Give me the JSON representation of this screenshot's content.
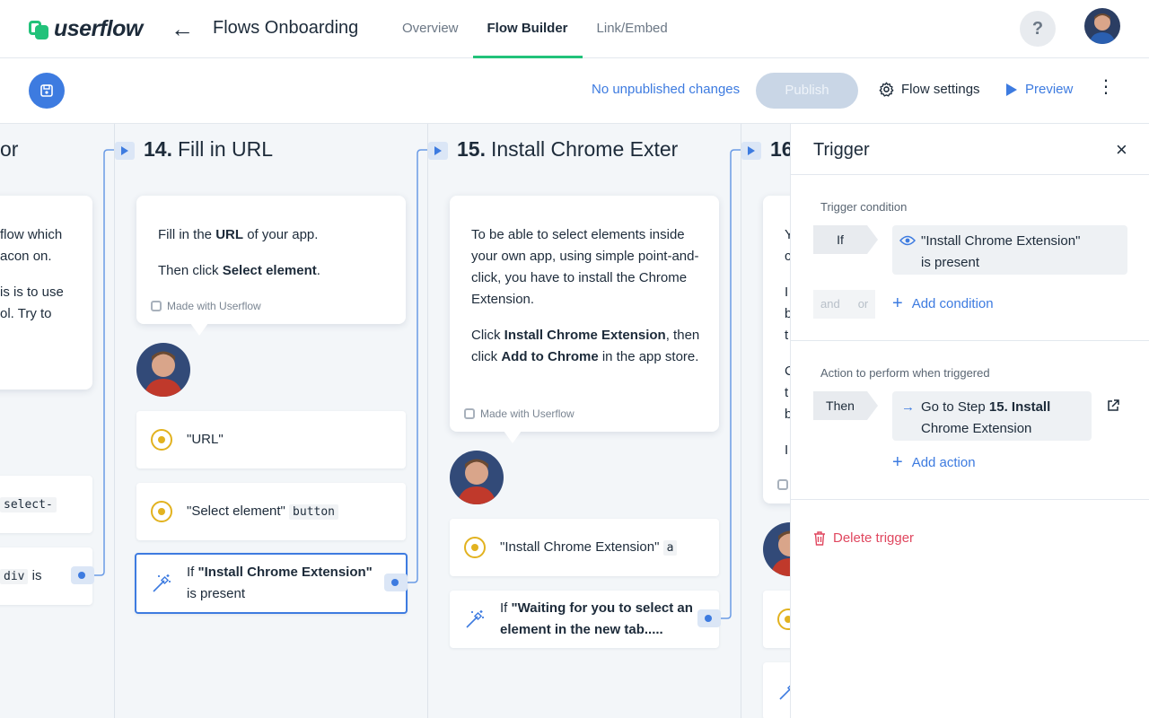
{
  "topnav": {
    "logo": "userflow",
    "flow_title": "Flows Onboarding",
    "tabs": [
      {
        "label": "Overview",
        "active": false
      },
      {
        "label": "Flow Builder",
        "active": true
      },
      {
        "label": "Link/Embed",
        "active": false
      }
    ],
    "help": "?"
  },
  "toolbar": {
    "status": "No unpublished changes",
    "publish": "Publish",
    "flow_settings": "Flow settings",
    "preview": "Preview"
  },
  "canvas": {
    "partial_left": {
      "title_fragment": "or",
      "bubble_lines": [
        "flow which",
        "acon on.",
        "is is to use",
        "ol. Try to"
      ],
      "trigger1_code": "select-",
      "trigger2_code": "div",
      "trigger2_text": "is"
    },
    "step14": {
      "number": "14.",
      "title": "Fill in URL",
      "bubble": {
        "p1_pre": "Fill in the ",
        "p1_bold": "URL",
        "p1_post": " of your app.",
        "p2_pre": "Then click ",
        "p2_bold": "Select element",
        "p2_post": "."
      },
      "made_with": "Made with Userflow",
      "triggers": [
        {
          "text": "\"URL\"",
          "code": ""
        },
        {
          "text": "\"Select element\"",
          "code": "button"
        }
      ],
      "condition": {
        "pre": "If ",
        "bold": "\"Install Chrome Extension\"",
        "post": "is present"
      }
    },
    "step15": {
      "number": "15.",
      "title": "Install Chrome Exter",
      "bubble": {
        "p1": "To be able to select elements inside your own app, using simple point-and-click, you have to install the Chrome Extension.",
        "p2_pre": "Click ",
        "p2_b1": "Install Chrome Extension",
        "p2_mid": ", then click ",
        "p2_b2": "Add to Chrome",
        "p2_post": " in the app store."
      },
      "made_with": "Made with Userflow",
      "trigger": {
        "text": "\"Install Chrome Extension\"",
        "code": "a"
      },
      "condition": {
        "pre": "If ",
        "bold": "\"Waiting for you to select an element in the new tab.....",
        "post": ""
      }
    },
    "step16": {
      "number": "16",
      "bubble_letters": [
        "Y",
        "c",
        "I",
        "b",
        "t",
        "C",
        "t",
        "b",
        "I"
      ]
    }
  },
  "panel": {
    "title": "Trigger",
    "close": "×",
    "trigger_condition_label": "Trigger condition",
    "if_label": "If",
    "condition_text": "\"Install Chrome Extension\"",
    "condition_sub": "is present",
    "and_label": "and",
    "or_label": "or",
    "add_condition": "Add condition",
    "action_label": "Action to perform when triggered",
    "then_label": "Then",
    "action_pre": "Go to Step ",
    "action_bold": "15. Install",
    "action_post": "Chrome Extension",
    "add_action": "Add action",
    "delete": "Delete trigger"
  },
  "colors": {
    "accent": "#3d7be0",
    "brand_green": "#22c27a",
    "danger": "#e0475f",
    "target_yellow": "#e2b21f"
  }
}
